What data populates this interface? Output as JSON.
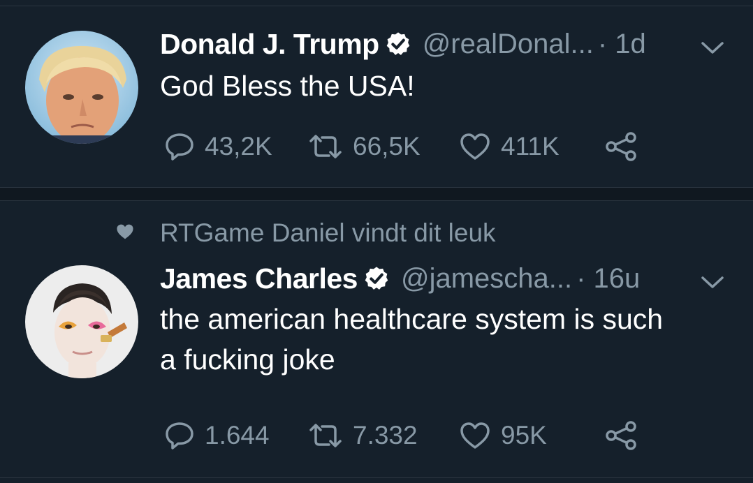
{
  "tweets": [
    {
      "author_name": "Donald J. Trump",
      "handle": "@realDonal...",
      "time": "· 1d",
      "text": "God Bless the USA!",
      "replies": "43,2K",
      "retweets": "66,5K",
      "likes": "411K",
      "verified_icon": "verified-badge-icon",
      "social_context": null
    },
    {
      "author_name": "James Charles",
      "handle": "@jamescha...",
      "time": "· 16u",
      "text_lines": [
        "the american healthcare system is such",
        "a fucking joke"
      ],
      "replies": "1.644",
      "retweets": "7.332",
      "likes": "95K",
      "verified_icon": "verified-badge-icon",
      "social_context": "RTGame Daniel vindt dit leuk"
    }
  ],
  "icons": {
    "reply": "speech-bubble-icon",
    "retweet": "retweet-arrows-icon",
    "like": "heart-outline-icon",
    "share": "share-nodes-icon",
    "menu": "chevron-down-icon"
  },
  "colors": {
    "background": "#15202b",
    "text": "#ffffff",
    "secondary_text": "#8899a6",
    "divider": "#2b3540"
  }
}
